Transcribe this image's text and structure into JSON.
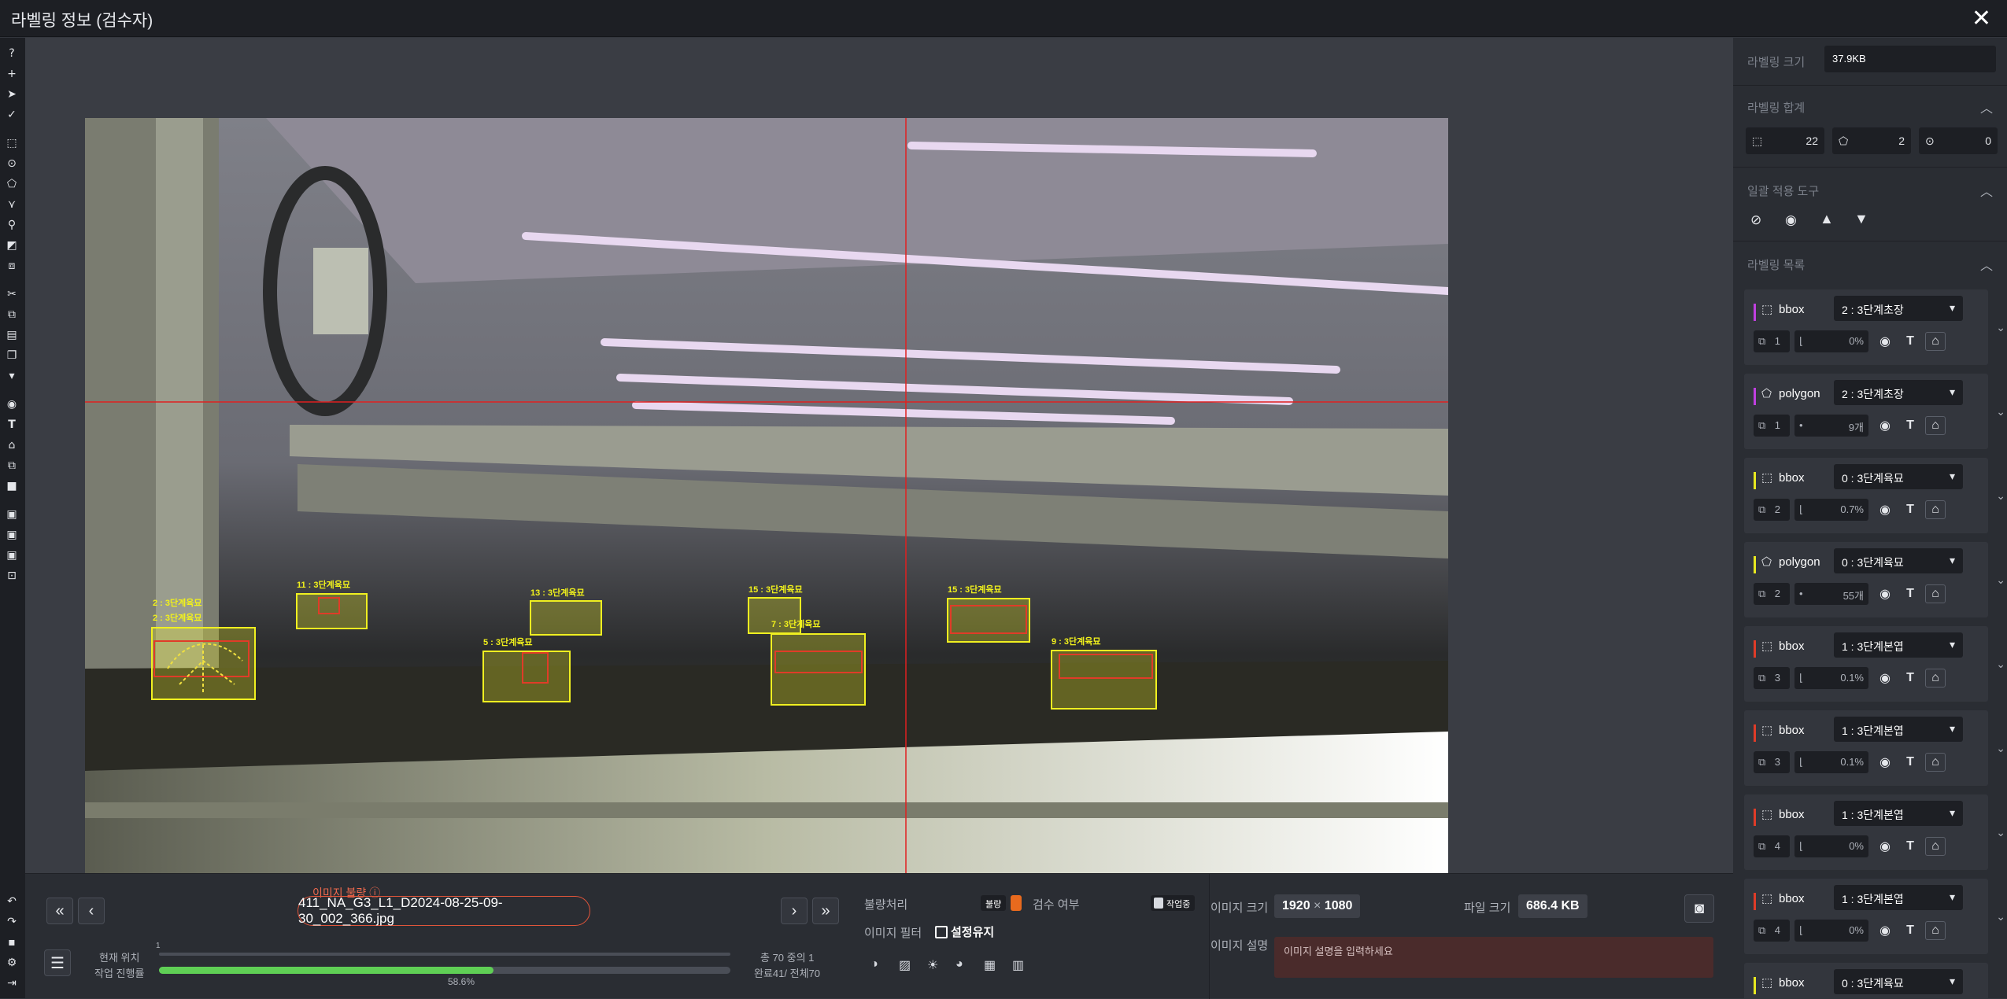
{
  "window": {
    "title": "라벨링 정보 (검수자)",
    "close": "✕"
  },
  "toolbar": {
    "icons": [
      "help-icon",
      "plus-icon",
      "cursor-icon",
      "check-icon",
      "bbox-icon",
      "point-icon",
      "polygon-icon",
      "polyline-icon",
      "skeleton-icon",
      "segment-icon",
      "cuboid-icon",
      "cut-icon",
      "copy-icon",
      "paste-icon",
      "duplicate-icon",
      "delete-icon",
      "eye-icon",
      "text-icon",
      "lock-icon",
      "layer-up-icon",
      "layer-down-icon",
      "image-icon",
      "image-save-icon",
      "image-load-icon",
      "image-fit-icon",
      "undo-icon",
      "redo-icon",
      "save-icon",
      "settings-icon",
      "logout-icon"
    ]
  },
  "annotations": [
    {
      "text": "2 : 3단계육묘"
    },
    {
      "text": "2 : 3단계육묘"
    },
    {
      "text": "11 : 3단계육묘"
    },
    {
      "text": "13 : 3단계육묘"
    },
    {
      "text": "5 : 3단계육묘"
    },
    {
      "text": "15 : 3단계육묘"
    },
    {
      "text": "7 : 3단계육묘"
    },
    {
      "text": "15 : 3단계육묘"
    },
    {
      "text": "9 : 3단계육묘"
    }
  ],
  "bottom": {
    "error_label": "이미지 불량",
    "filename": "411_NA_G3_L1_D2024-08-25-09-30_002_366.jpg",
    "position_label": "현재 위치",
    "progress_label": "작업 진행률",
    "position_value": "1",
    "progress_percent": 58.6,
    "progress_text": "58.6%",
    "total_text": "총 70 중의 1",
    "done_text": "완료41/ 전체70",
    "defect_label": "불량처리",
    "defect_tag": "불량",
    "inspect_label": "검수 여부",
    "inspect_tag": "작업중",
    "filter_label": "이미지 필터",
    "keep_setting": "설정유지",
    "size_label": "이미지 크기",
    "width": "1920",
    "times": "×",
    "height": "1080",
    "filesize_label": "파일 크기",
    "filesize": "686.4 KB",
    "desc_label": "이미지 설명",
    "desc_placeholder": "이미지 설명을 입력하세요"
  },
  "panel": {
    "size_label": "라벨링 크기",
    "size_value": "37.9KB",
    "sum_label": "라벨링 합계",
    "counts": [
      "22",
      "2",
      "0"
    ],
    "bulk_label": "일괄 적용 도구",
    "list_label": "라벨링 목록",
    "items": [
      {
        "type": "bbox",
        "cls": "2 : 3단계초장",
        "id": "1",
        "val": "0%",
        "color": "#c040e0"
      },
      {
        "type": "polygon",
        "cls": "2 : 3단계초장",
        "id": "1",
        "val": "9개",
        "color": "#c040e0"
      },
      {
        "type": "bbox",
        "cls": "0 : 3단계육묘",
        "id": "2",
        "val": "0.7%",
        "color": "#e8e820"
      },
      {
        "type": "polygon",
        "cls": "0 : 3단계육묘",
        "id": "2",
        "val": "55개",
        "color": "#e8e820"
      },
      {
        "type": "bbox",
        "cls": "1 : 3단계본엽",
        "id": "3",
        "val": "0.1%",
        "color": "#e03c28"
      },
      {
        "type": "bbox",
        "cls": "1 : 3단계본엽",
        "id": "3",
        "val": "0.1%",
        "color": "#e03c28"
      },
      {
        "type": "bbox",
        "cls": "1 : 3단계본엽",
        "id": "4",
        "val": "0%",
        "color": "#e03c28"
      },
      {
        "type": "bbox",
        "cls": "1 : 3단계본엽",
        "id": "4",
        "val": "0%",
        "color": "#e03c28"
      },
      {
        "type": "bbox",
        "cls": "0 : 3단계육묘",
        "id": "",
        "val": "",
        "color": "#e8e820"
      }
    ]
  }
}
